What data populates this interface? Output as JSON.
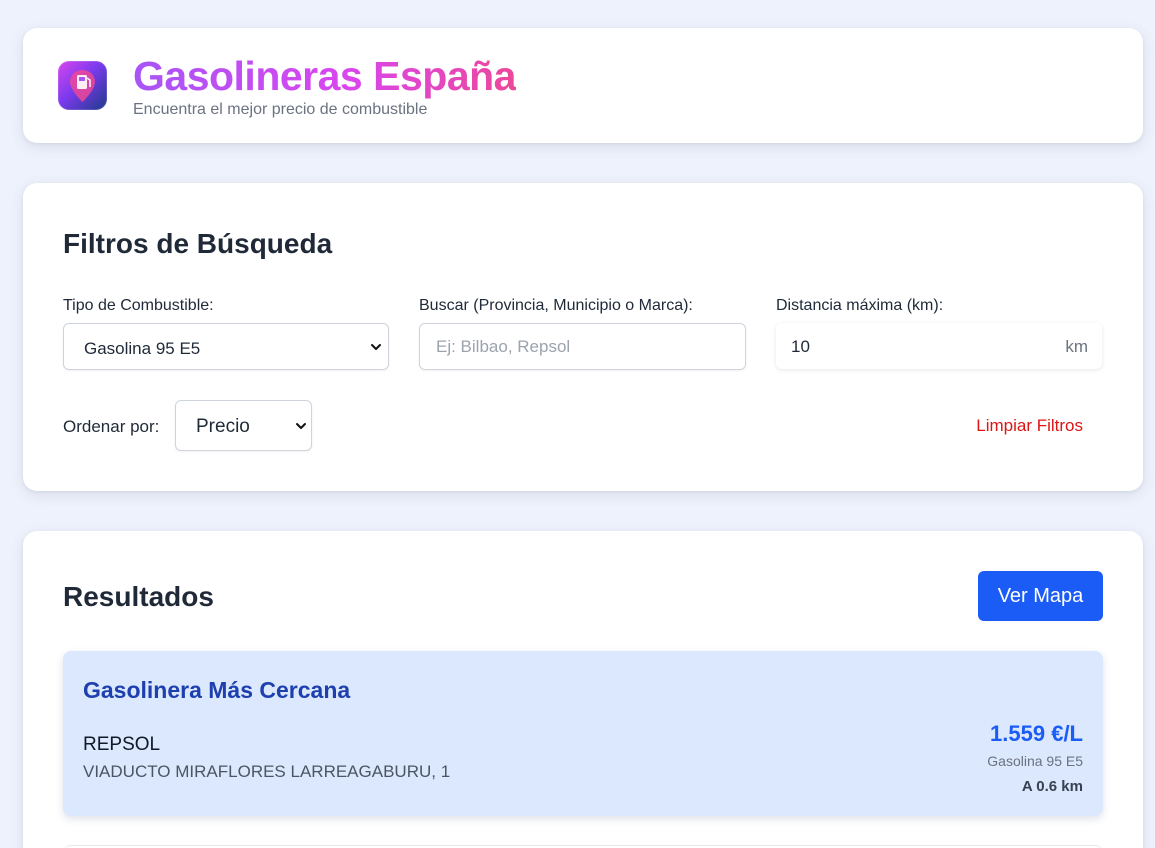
{
  "header": {
    "logo_icon": "fuel-pump-pin-icon",
    "title": "Gasolineras España",
    "subtitle": "Encuentra el mejor precio de combustible",
    "title_gradient": [
      "#a855f7",
      "#d946ef",
      "#ec4899"
    ]
  },
  "filters": {
    "title": "Filtros de Búsqueda",
    "fuel_label": "Tipo de Combustible:",
    "fuel_selected": "Gasolina 95 E5",
    "search_label": "Buscar (Provincia, Municipio o Marca):",
    "search_placeholder": "Ej: Bilbao, Repsol",
    "search_value": "",
    "distance_label": "Distancia máxima (km):",
    "distance_value": "10",
    "distance_unit": "km",
    "sort_label": "Ordenar por:",
    "sort_selected": "Precio",
    "clear_label": "Limpiar Filtros",
    "clear_color": "#dc1414"
  },
  "results": {
    "title": "Resultados",
    "map_button": "Ver Mapa",
    "accent": "#1a5cf5",
    "nearest": {
      "heading": "Gasolinera Más Cercana",
      "brand": "REPSOL",
      "address": "VIADUCTO MIRAFLORES LARREAGABURU, 1",
      "price": "1.559 €/L",
      "fuel": "Gasolina 95 E5",
      "distance": "A 0.6 km"
    }
  }
}
